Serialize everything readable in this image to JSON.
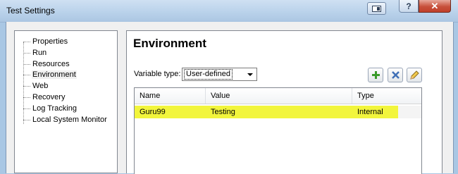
{
  "window": {
    "title": "Test Settings",
    "help_label": "?",
    "close_label": "✕"
  },
  "tree": {
    "items": [
      {
        "label": "Properties"
      },
      {
        "label": "Run"
      },
      {
        "label": "Resources"
      },
      {
        "label": "Environment",
        "selected": true
      },
      {
        "label": "Web"
      },
      {
        "label": "Recovery"
      },
      {
        "label": "Log Tracking"
      },
      {
        "label": "Local System Monitor"
      }
    ]
  },
  "panel": {
    "title": "Environment",
    "variable_type_label": "Variable type:",
    "variable_type_value": "User-defined"
  },
  "grid": {
    "columns": [
      "Name",
      "Value",
      "Type"
    ],
    "rows": [
      {
        "name": "Guru99",
        "value": "Testing",
        "type": "Internal",
        "highlight_color": "#f2f53c"
      }
    ]
  },
  "toolbar": {
    "add_icon": "plus-icon",
    "delete_icon": "x-icon",
    "edit_icon": "pencil-icon"
  }
}
